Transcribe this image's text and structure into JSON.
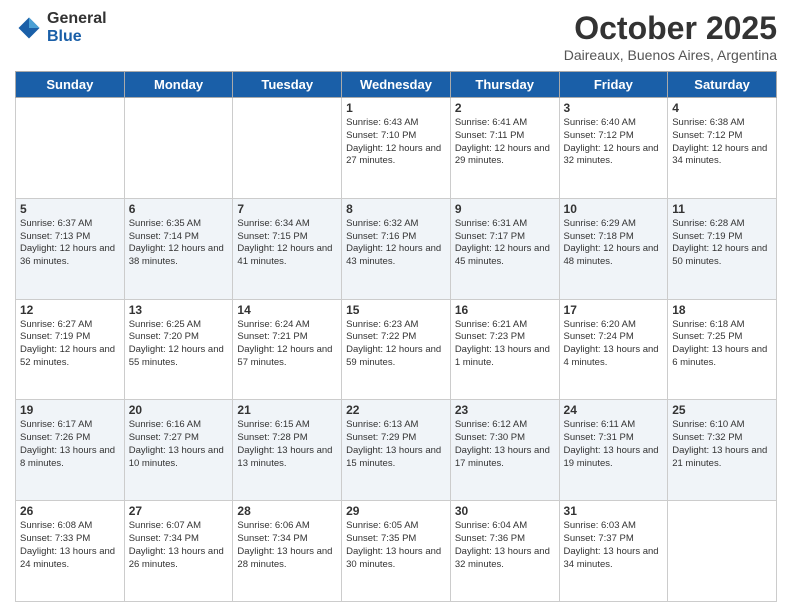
{
  "logo": {
    "general": "General",
    "blue": "Blue"
  },
  "header": {
    "month": "October 2025",
    "location": "Daireaux, Buenos Aires, Argentina"
  },
  "days_of_week": [
    "Sunday",
    "Monday",
    "Tuesday",
    "Wednesday",
    "Thursday",
    "Friday",
    "Saturday"
  ],
  "weeks": [
    [
      {
        "day": "",
        "info": ""
      },
      {
        "day": "",
        "info": ""
      },
      {
        "day": "",
        "info": ""
      },
      {
        "day": "1",
        "info": "Sunrise: 6:43 AM\nSunset: 7:10 PM\nDaylight: 12 hours and 27 minutes."
      },
      {
        "day": "2",
        "info": "Sunrise: 6:41 AM\nSunset: 7:11 PM\nDaylight: 12 hours and 29 minutes."
      },
      {
        "day": "3",
        "info": "Sunrise: 6:40 AM\nSunset: 7:12 PM\nDaylight: 12 hours and 32 minutes."
      },
      {
        "day": "4",
        "info": "Sunrise: 6:38 AM\nSunset: 7:12 PM\nDaylight: 12 hours and 34 minutes."
      }
    ],
    [
      {
        "day": "5",
        "info": "Sunrise: 6:37 AM\nSunset: 7:13 PM\nDaylight: 12 hours and 36 minutes."
      },
      {
        "day": "6",
        "info": "Sunrise: 6:35 AM\nSunset: 7:14 PM\nDaylight: 12 hours and 38 minutes."
      },
      {
        "day": "7",
        "info": "Sunrise: 6:34 AM\nSunset: 7:15 PM\nDaylight: 12 hours and 41 minutes."
      },
      {
        "day": "8",
        "info": "Sunrise: 6:32 AM\nSunset: 7:16 PM\nDaylight: 12 hours and 43 minutes."
      },
      {
        "day": "9",
        "info": "Sunrise: 6:31 AM\nSunset: 7:17 PM\nDaylight: 12 hours and 45 minutes."
      },
      {
        "day": "10",
        "info": "Sunrise: 6:29 AM\nSunset: 7:18 PM\nDaylight: 12 hours and 48 minutes."
      },
      {
        "day": "11",
        "info": "Sunrise: 6:28 AM\nSunset: 7:19 PM\nDaylight: 12 hours and 50 minutes."
      }
    ],
    [
      {
        "day": "12",
        "info": "Sunrise: 6:27 AM\nSunset: 7:19 PM\nDaylight: 12 hours and 52 minutes."
      },
      {
        "day": "13",
        "info": "Sunrise: 6:25 AM\nSunset: 7:20 PM\nDaylight: 12 hours and 55 minutes."
      },
      {
        "day": "14",
        "info": "Sunrise: 6:24 AM\nSunset: 7:21 PM\nDaylight: 12 hours and 57 minutes."
      },
      {
        "day": "15",
        "info": "Sunrise: 6:23 AM\nSunset: 7:22 PM\nDaylight: 12 hours and 59 minutes."
      },
      {
        "day": "16",
        "info": "Sunrise: 6:21 AM\nSunset: 7:23 PM\nDaylight: 13 hours and 1 minute."
      },
      {
        "day": "17",
        "info": "Sunrise: 6:20 AM\nSunset: 7:24 PM\nDaylight: 13 hours and 4 minutes."
      },
      {
        "day": "18",
        "info": "Sunrise: 6:18 AM\nSunset: 7:25 PM\nDaylight: 13 hours and 6 minutes."
      }
    ],
    [
      {
        "day": "19",
        "info": "Sunrise: 6:17 AM\nSunset: 7:26 PM\nDaylight: 13 hours and 8 minutes."
      },
      {
        "day": "20",
        "info": "Sunrise: 6:16 AM\nSunset: 7:27 PM\nDaylight: 13 hours and 10 minutes."
      },
      {
        "day": "21",
        "info": "Sunrise: 6:15 AM\nSunset: 7:28 PM\nDaylight: 13 hours and 13 minutes."
      },
      {
        "day": "22",
        "info": "Sunrise: 6:13 AM\nSunset: 7:29 PM\nDaylight: 13 hours and 15 minutes."
      },
      {
        "day": "23",
        "info": "Sunrise: 6:12 AM\nSunset: 7:30 PM\nDaylight: 13 hours and 17 minutes."
      },
      {
        "day": "24",
        "info": "Sunrise: 6:11 AM\nSunset: 7:31 PM\nDaylight: 13 hours and 19 minutes."
      },
      {
        "day": "25",
        "info": "Sunrise: 6:10 AM\nSunset: 7:32 PM\nDaylight: 13 hours and 21 minutes."
      }
    ],
    [
      {
        "day": "26",
        "info": "Sunrise: 6:08 AM\nSunset: 7:33 PM\nDaylight: 13 hours and 24 minutes."
      },
      {
        "day": "27",
        "info": "Sunrise: 6:07 AM\nSunset: 7:34 PM\nDaylight: 13 hours and 26 minutes."
      },
      {
        "day": "28",
        "info": "Sunrise: 6:06 AM\nSunset: 7:34 PM\nDaylight: 13 hours and 28 minutes."
      },
      {
        "day": "29",
        "info": "Sunrise: 6:05 AM\nSunset: 7:35 PM\nDaylight: 13 hours and 30 minutes."
      },
      {
        "day": "30",
        "info": "Sunrise: 6:04 AM\nSunset: 7:36 PM\nDaylight: 13 hours and 32 minutes."
      },
      {
        "day": "31",
        "info": "Sunrise: 6:03 AM\nSunset: 7:37 PM\nDaylight: 13 hours and 34 minutes."
      },
      {
        "day": "",
        "info": ""
      }
    ]
  ]
}
